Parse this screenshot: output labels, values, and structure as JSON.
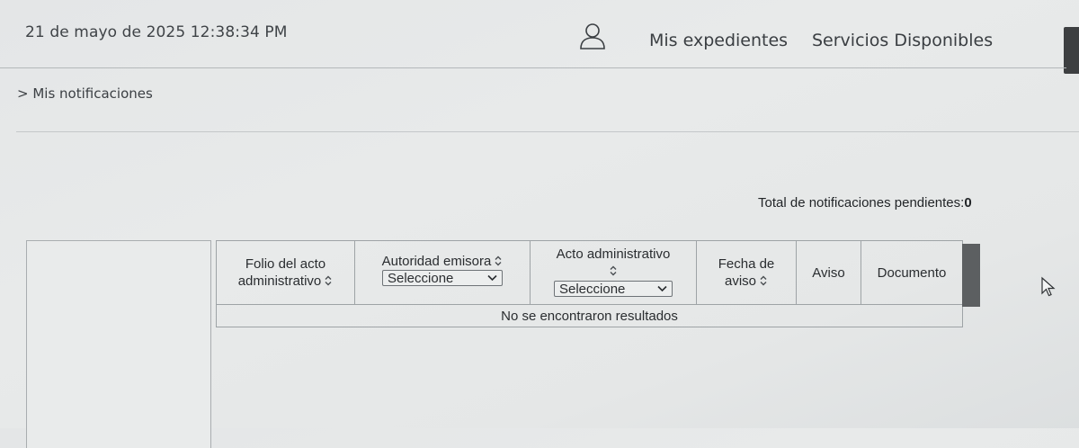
{
  "header": {
    "datetime": "21 de mayo de 2025 12:38:34 PM",
    "user_icon": "user-icon",
    "nav": [
      {
        "label": "Mis expedientes"
      },
      {
        "label": "Servicios Disponibles"
      }
    ]
  },
  "breadcrumb": {
    "text": "> Mis notificaciones"
  },
  "summary": {
    "label": "Total de notificaciones pendientes:",
    "count": "0"
  },
  "table": {
    "columns": [
      {
        "label_line1": "Folio del acto",
        "label_line2": "administrativo",
        "sortable": true
      },
      {
        "label": "Autoridad emisora",
        "sortable": true,
        "filter": "Seleccione"
      },
      {
        "label": "Acto administrativo",
        "sortable": true,
        "filter": "Seleccione"
      },
      {
        "label_line1": "Fecha de",
        "label_line2": "aviso",
        "sortable": true
      },
      {
        "label": "Aviso",
        "sortable": false
      },
      {
        "label": "Documento",
        "sortable": false
      }
    ],
    "empty_message": "No se encontraron resultados"
  },
  "colors": {
    "background": "#e6e8e8",
    "text": "#2b2e31",
    "border": "#9ea3a6",
    "scrollbar": "#3d3f41"
  }
}
